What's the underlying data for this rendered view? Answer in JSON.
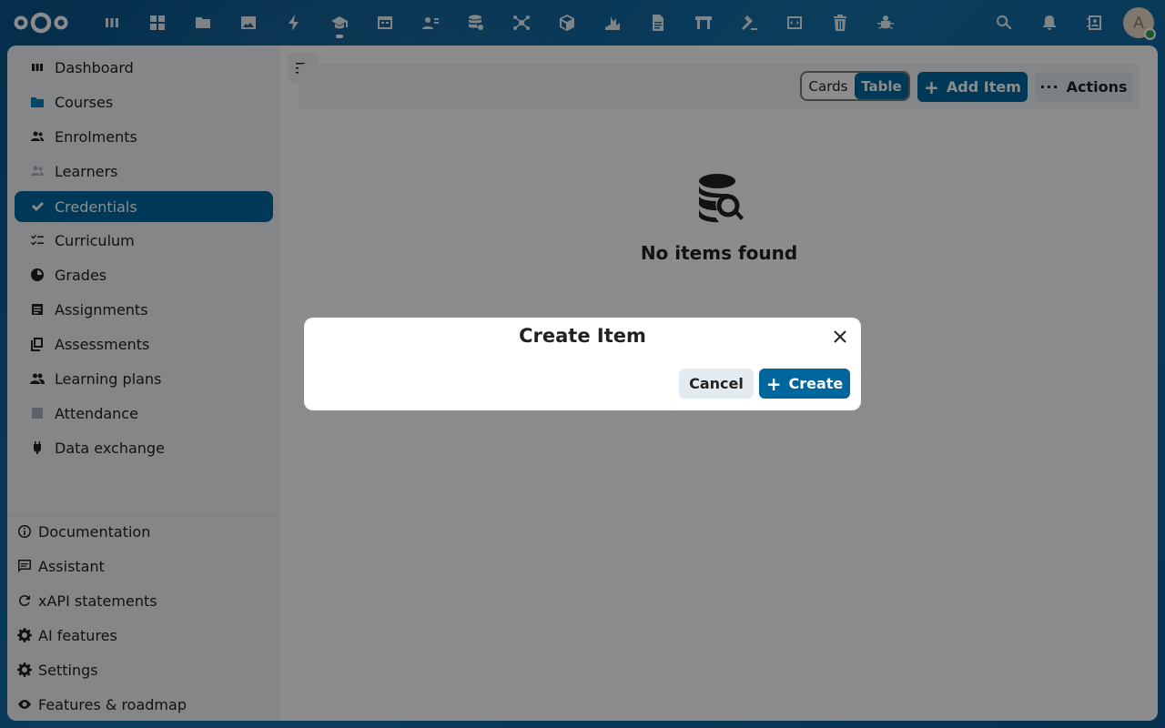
{
  "topbar": {
    "apps": [
      "dashboard-icon",
      "apps-grid-icon",
      "files-icon",
      "photos-icon",
      "activity-icon",
      "learning-icon",
      "calendar-icon",
      "contacts-icon",
      "database-icon",
      "hub-icon",
      "package-icon",
      "stats-icon",
      "document-icon",
      "board-icon",
      "gavel-icon",
      "code-icon",
      "trash-icon",
      "bug-icon"
    ],
    "active_app_index": 5,
    "avatar_letter": "A"
  },
  "sidebar": {
    "items": [
      {
        "label": "Dashboard",
        "icon": "dashboard-icon"
      },
      {
        "label": "Courses",
        "icon": "folder-icon"
      },
      {
        "label": "Enrolments",
        "icon": "people-icon"
      },
      {
        "label": "Learners",
        "icon": "learners-icon"
      },
      {
        "label": "Credentials",
        "icon": "check-icon"
      },
      {
        "label": "Curriculum",
        "icon": "checklist-icon"
      },
      {
        "label": "Grades",
        "icon": "pie-icon"
      },
      {
        "label": "Assignments",
        "icon": "assignment-icon"
      },
      {
        "label": "Assessments",
        "icon": "copy-icon"
      },
      {
        "label": "Learning plans",
        "icon": "group-icon"
      },
      {
        "label": "Attendance",
        "icon": "calendar-icon"
      },
      {
        "label": "Data exchange",
        "icon": "plug-icon"
      }
    ],
    "active_index": 4,
    "bottom_items": [
      {
        "label": "Documentation",
        "icon": "info-icon"
      },
      {
        "label": "Assistant",
        "icon": "chat-icon"
      },
      {
        "label": "xAPI statements",
        "icon": "refresh-icon"
      },
      {
        "label": "AI features",
        "icon": "cog-icon"
      },
      {
        "label": "Settings",
        "icon": "settings-icon"
      },
      {
        "label": "Features & roadmap",
        "icon": "eye-icon"
      }
    ]
  },
  "toolbar": {
    "view_cards": "Cards",
    "view_table": "Table",
    "add_item": "Add Item",
    "actions": "Actions"
  },
  "empty": {
    "title": "No items found"
  },
  "modal": {
    "title": "Create Item",
    "cancel": "Cancel",
    "create": "Create"
  },
  "colors": {
    "primary": "#00679e",
    "background": "#0f5f93"
  }
}
